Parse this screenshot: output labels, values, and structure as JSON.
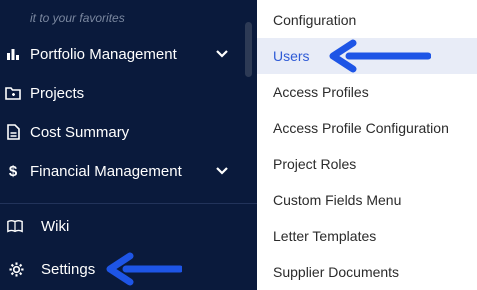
{
  "sidebar": {
    "hint": "it to your favorites",
    "items": [
      {
        "label": "Portfolio Management",
        "icon": "bar-chart-icon",
        "expandable": true
      },
      {
        "label": "Projects",
        "icon": "folder-icon",
        "expandable": false
      },
      {
        "label": "Cost Summary",
        "icon": "document-icon",
        "expandable": false
      },
      {
        "label": "Financial Management",
        "icon": "dollar-icon",
        "expandable": true
      },
      {
        "label": "Wiki",
        "icon": "book-icon",
        "expandable": false
      },
      {
        "label": "Settings",
        "icon": "gear-icon",
        "expandable": false
      }
    ]
  },
  "submenu": {
    "items": [
      {
        "label": "Configuration"
      },
      {
        "label": "Users",
        "active": true
      },
      {
        "label": "Access Profiles"
      },
      {
        "label": "Access Profile Configuration"
      },
      {
        "label": "Project Roles"
      },
      {
        "label": "Custom Fields Menu"
      },
      {
        "label": "Letter Templates"
      },
      {
        "label": "Supplier Documents"
      }
    ]
  },
  "colors": {
    "sidebar_bg": "#0a1a3c",
    "active_bg": "#e8ecf7",
    "accent": "#2f5bd6",
    "arrow": "#1e55e6"
  }
}
